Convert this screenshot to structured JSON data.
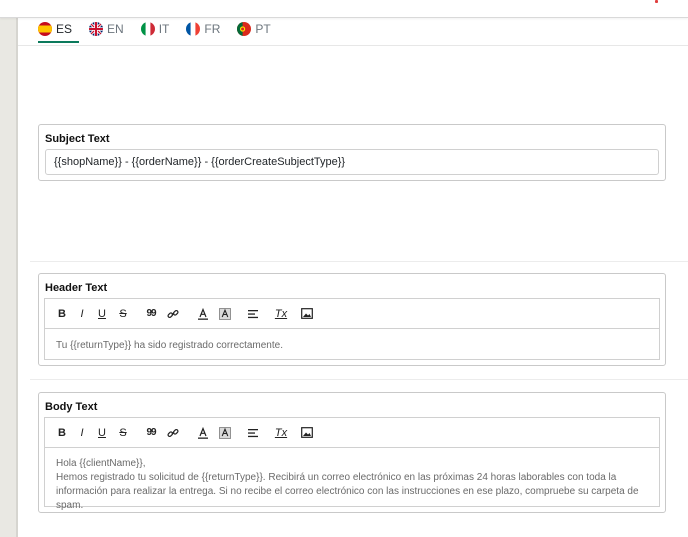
{
  "languages": [
    {
      "code": "ES",
      "active": true
    },
    {
      "code": "EN",
      "active": false
    },
    {
      "code": "IT",
      "active": false
    },
    {
      "code": "FR",
      "active": false
    },
    {
      "code": "PT",
      "active": false
    }
  ],
  "subject": {
    "title": "Subject Text",
    "value": "{{shopName}} - {{orderName}} - {{orderCreateSubjectType}}"
  },
  "header": {
    "title": "Header Text",
    "content": "Tu {{returnType}} ha sido registrado correctamente."
  },
  "body": {
    "title": "Body Text",
    "lines": [
      "Hola {{clientName}},",
      "Hemos registrado tu solicitud de {{returnType}}. Recibirá un correo electrónico en las próximas 24 horas laborables con toda la información para realizar la entrega. Si no recibe el correo electrónico con las instrucciones en ese plazo, compruebe su carpeta de spam."
    ]
  },
  "toolbar": {
    "bold": "B",
    "italic": "I",
    "underline": "U",
    "strike": "S",
    "quote": "99",
    "clear": "Tx"
  },
  "colors": {
    "accent": "#0b7a5c",
    "border": "#c9c9c9"
  }
}
